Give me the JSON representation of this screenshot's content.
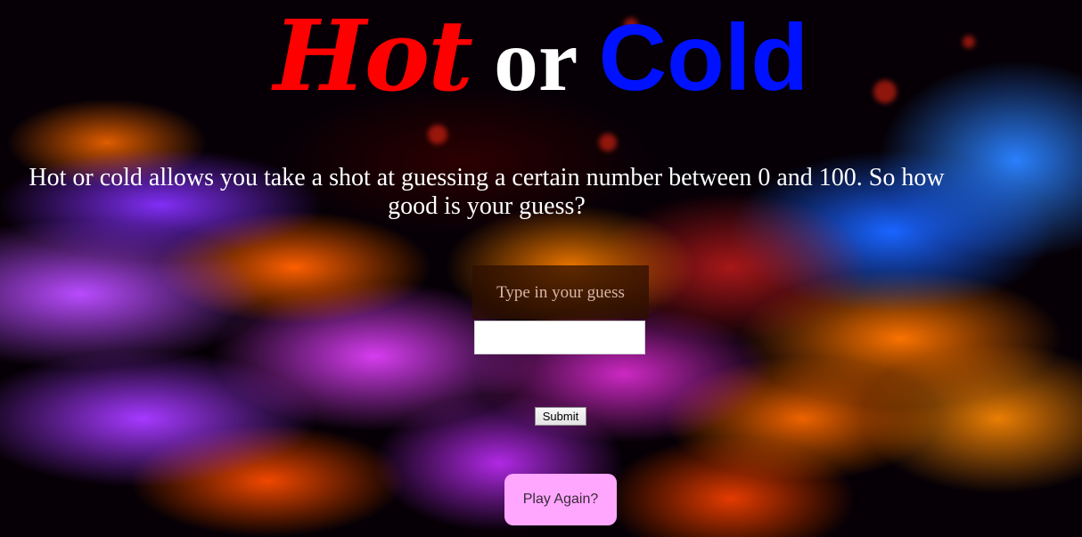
{
  "title": {
    "hot": "Hot",
    "or": "or",
    "cold": "Cold"
  },
  "description": "Hot or cold allows you take a shot at guessing a certain number between 0 and 100. So how good is your guess?",
  "guess": {
    "label": "Type in your guess",
    "value": ""
  },
  "buttons": {
    "submit": "Submit",
    "play_again": "Play Again?"
  },
  "colors": {
    "hot": "#ff0000",
    "cold": "#0011ff",
    "play_again_bg": "#ffa6ff"
  }
}
